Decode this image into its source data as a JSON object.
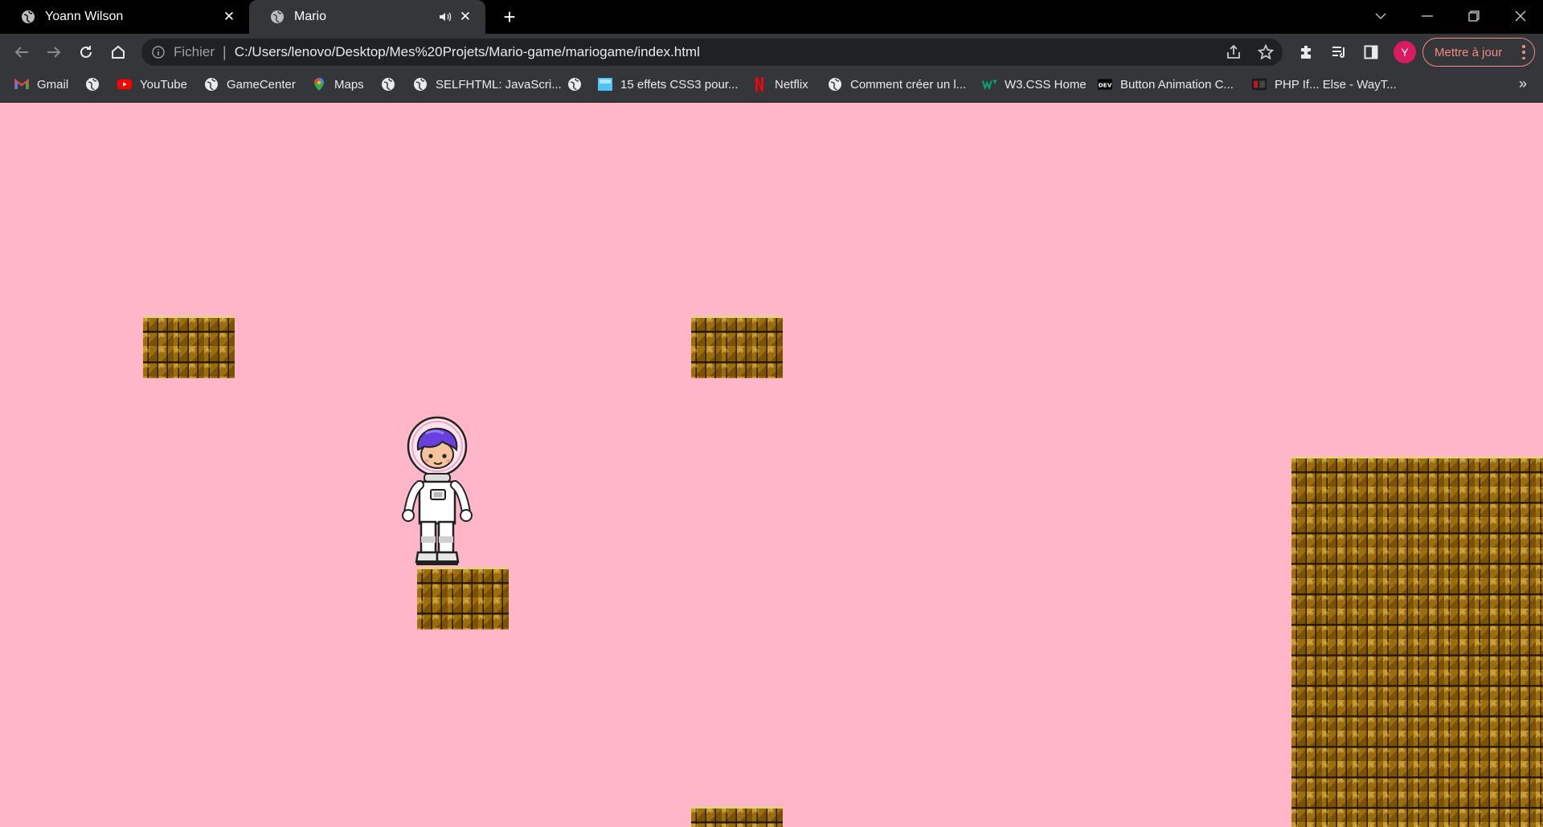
{
  "browser": {
    "tabs": [
      {
        "title": "Yoann Wilson",
        "active": false
      },
      {
        "title": "Mario",
        "active": true,
        "audio": true
      }
    ],
    "address": {
      "scheme_label": "Fichier",
      "url": "C:/Users/lenovo/Desktop/Mes%20Projets/Mario-game/mariogame/index.html"
    },
    "profile_initial": "Y",
    "update_button": "Mettre à jour",
    "bookmarks": [
      {
        "label": "Gmail",
        "icon": "gmail-icon"
      },
      {
        "label": "",
        "icon": "globe-icon"
      },
      {
        "label": "YouTube",
        "icon": "youtube-icon"
      },
      {
        "label": "GameCenter",
        "icon": "globe-icon"
      },
      {
        "label": "Maps",
        "icon": "maps-icon"
      },
      {
        "label": "",
        "icon": "globe-icon"
      },
      {
        "label": "SELFHTML: JavaScri...",
        "icon": "globe-icon"
      },
      {
        "label": "",
        "icon": "globe-icon"
      },
      {
        "label": "15 effets CSS3 pour...",
        "icon": "image-icon"
      },
      {
        "label": "Netflix",
        "icon": "netflix-icon"
      },
      {
        "label": "Comment créer un l...",
        "icon": "globe-icon"
      },
      {
        "label": "W3.CSS Home",
        "icon": "w3-icon"
      },
      {
        "label": "Button Animation C...",
        "icon": "dev-icon"
      },
      {
        "label": "PHP If... Else - WayT...",
        "icon": "wayt-icon"
      }
    ],
    "colors": {
      "tabstrip": "#000000",
      "toolbar": "#35363a",
      "omnibox": "#202124",
      "accent_update": "#f28b82",
      "avatar": "#d81b60"
    }
  },
  "game": {
    "background": "#ffb6c9",
    "character": "astronaut-kid-with-purple-hair",
    "brick_color": "#996b0a"
  }
}
